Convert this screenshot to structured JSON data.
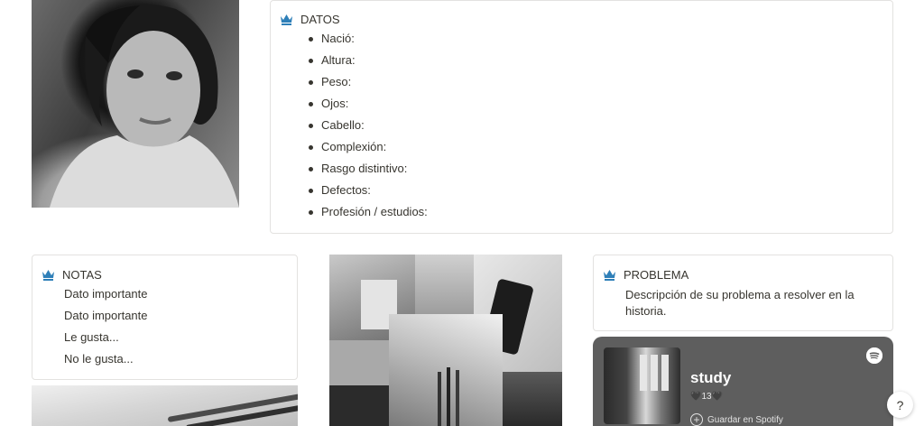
{
  "colors": {
    "crown": "#2e7fb8",
    "spotify_bg": "#5e5e5e",
    "text": "#37352f"
  },
  "datos": {
    "icon": "crown-icon",
    "title": "DATOS",
    "items": [
      "Nació:",
      "Altura:",
      "Peso:",
      "Ojos:",
      "Cabello:",
      "Complexión:",
      "Rasgo distintivo:",
      "Defectos:",
      "Profesión / estudios:"
    ]
  },
  "notas": {
    "icon": "crown-icon",
    "title": "NOTAS",
    "lines": [
      "Dato importante",
      "Dato importante",
      "Le gusta...",
      "No le gusta..."
    ]
  },
  "problema": {
    "icon": "crown-icon",
    "title": "PROBLEMA",
    "description": "Descripción de su problema a resolver en la historia."
  },
  "spotify": {
    "title": "study",
    "meta": "🖤13🖤",
    "save_label": "Guardar en Spotify",
    "logo_icon": "spotify-icon"
  },
  "help": {
    "label": "?"
  }
}
